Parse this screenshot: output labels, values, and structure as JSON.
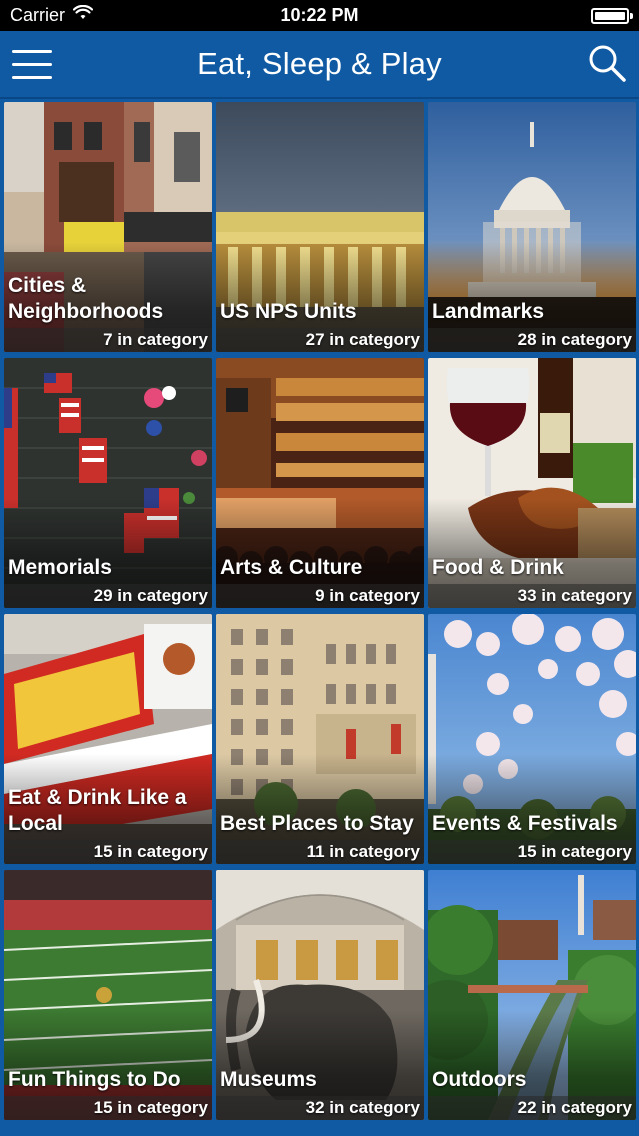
{
  "status_bar": {
    "carrier": "Carrier",
    "time": "10:22 PM",
    "battery_level": 1.0
  },
  "header": {
    "title": "Eat, Sleep & Play",
    "menu_icon": "hamburger-menu-icon",
    "search_icon": "search-icon",
    "background": "#0f5aa3"
  },
  "categories": [
    {
      "label": "Cities & Neighborhoods",
      "count": "7 in category"
    },
    {
      "label": "US NPS Units",
      "count": "27 in category"
    },
    {
      "label": "Landmarks",
      "count": "28 in category"
    },
    {
      "label": "Memorials",
      "count": "29 in category"
    },
    {
      "label": "Arts & Culture",
      "count": "9 in category"
    },
    {
      "label": "Food & Drink",
      "count": "33 in category"
    },
    {
      "label": "Eat & Drink Like a Local",
      "count": "15 in category"
    },
    {
      "label": "Best Places to Stay",
      "count": "11 in category"
    },
    {
      "label": "Events & Festivals",
      "count": "15 in category"
    },
    {
      "label": "Fun Things to Do",
      "count": "15 in category"
    },
    {
      "label": "Museums",
      "count": "32 in category"
    },
    {
      "label": "Outdoors",
      "count": "22 in category"
    }
  ]
}
